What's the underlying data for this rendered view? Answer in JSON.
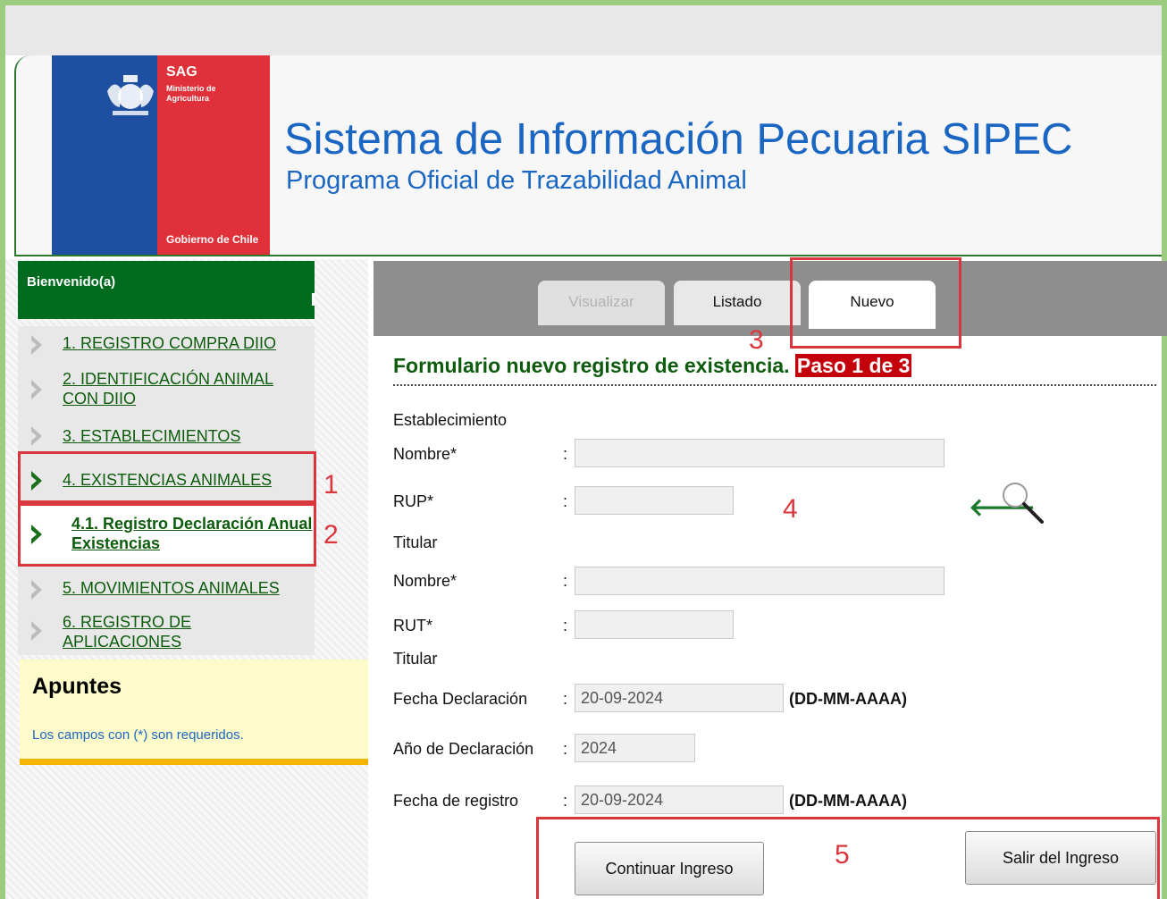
{
  "header": {
    "logo": {
      "sag": "SAG",
      "ministry": "Ministerio de Agricultura",
      "government": "Gobierno de Chile"
    },
    "title": "Sistema de Información Pecuaria SIPEC",
    "subtitle": "Programa Oficial de Trazabilidad Animal"
  },
  "sidebar": {
    "welcome": "Bienvenido(a)",
    "items": [
      {
        "label": "1. REGISTRO COMPRA DIIO"
      },
      {
        "label": "2. IDENTIFICACIÓN ANIMAL CON DIIO"
      },
      {
        "label": "3. ESTABLECIMIENTOS"
      },
      {
        "label": "4. EXISTENCIAS ANIMALES",
        "active": true
      },
      {
        "label": "4.1. Registro Declaración Anual Existencias",
        "sub": true
      },
      {
        "label": "5. MOVIMIENTOS ANIMALES"
      },
      {
        "label": "6. REGISTRO DE APLICACIONES"
      }
    ],
    "notes_title": "Apuntes",
    "notes_text": "Los campos con (*) son requeridos."
  },
  "tabs": [
    {
      "label": "Visualizar",
      "state": "disabled"
    },
    {
      "label": "Listado",
      "state": "normal"
    },
    {
      "label": "Nuevo",
      "state": "selected"
    }
  ],
  "form": {
    "title": "Formulario nuevo registro de existencia.",
    "step": "Paso 1 de 3",
    "section_establecimiento": "Establecimiento",
    "est_nombre_label": "Nombre*",
    "est_nombre_value": "",
    "rup_label": "RUP*",
    "rup_value": "",
    "section_titular": "Titular",
    "tit_nombre_label": "Nombre*",
    "tit_nombre_value": "",
    "rut_label": "RUT*",
    "rut_value": "",
    "section_titular2": "Titular",
    "fecha_decl_label": "Fecha Declaración",
    "fecha_decl_value": "20-09-2024",
    "anio_decl_label": "Año de Declaración",
    "anio_decl_value": "2024",
    "fecha_reg_label": "Fecha de registro",
    "fecha_reg_value": "20-09-2024",
    "date_format": "(DD-MM-AAAA)",
    "colon": ":"
  },
  "buttons": {
    "continue": "Continuar Ingreso",
    "exit": "Salir del Ingreso"
  },
  "annotations": [
    "1",
    "2",
    "3",
    "4",
    "5"
  ],
  "colors": {
    "accent_green": "#006a1e",
    "link_green": "#0d5c0d",
    "title_blue": "#1a66c2",
    "annotation_red": "#d9363e",
    "step_red": "#c4000b"
  },
  "icons": [
    "coat-of-arms-icon",
    "chevron-right-icon",
    "arrow-left-icon",
    "magnifier-icon"
  ]
}
